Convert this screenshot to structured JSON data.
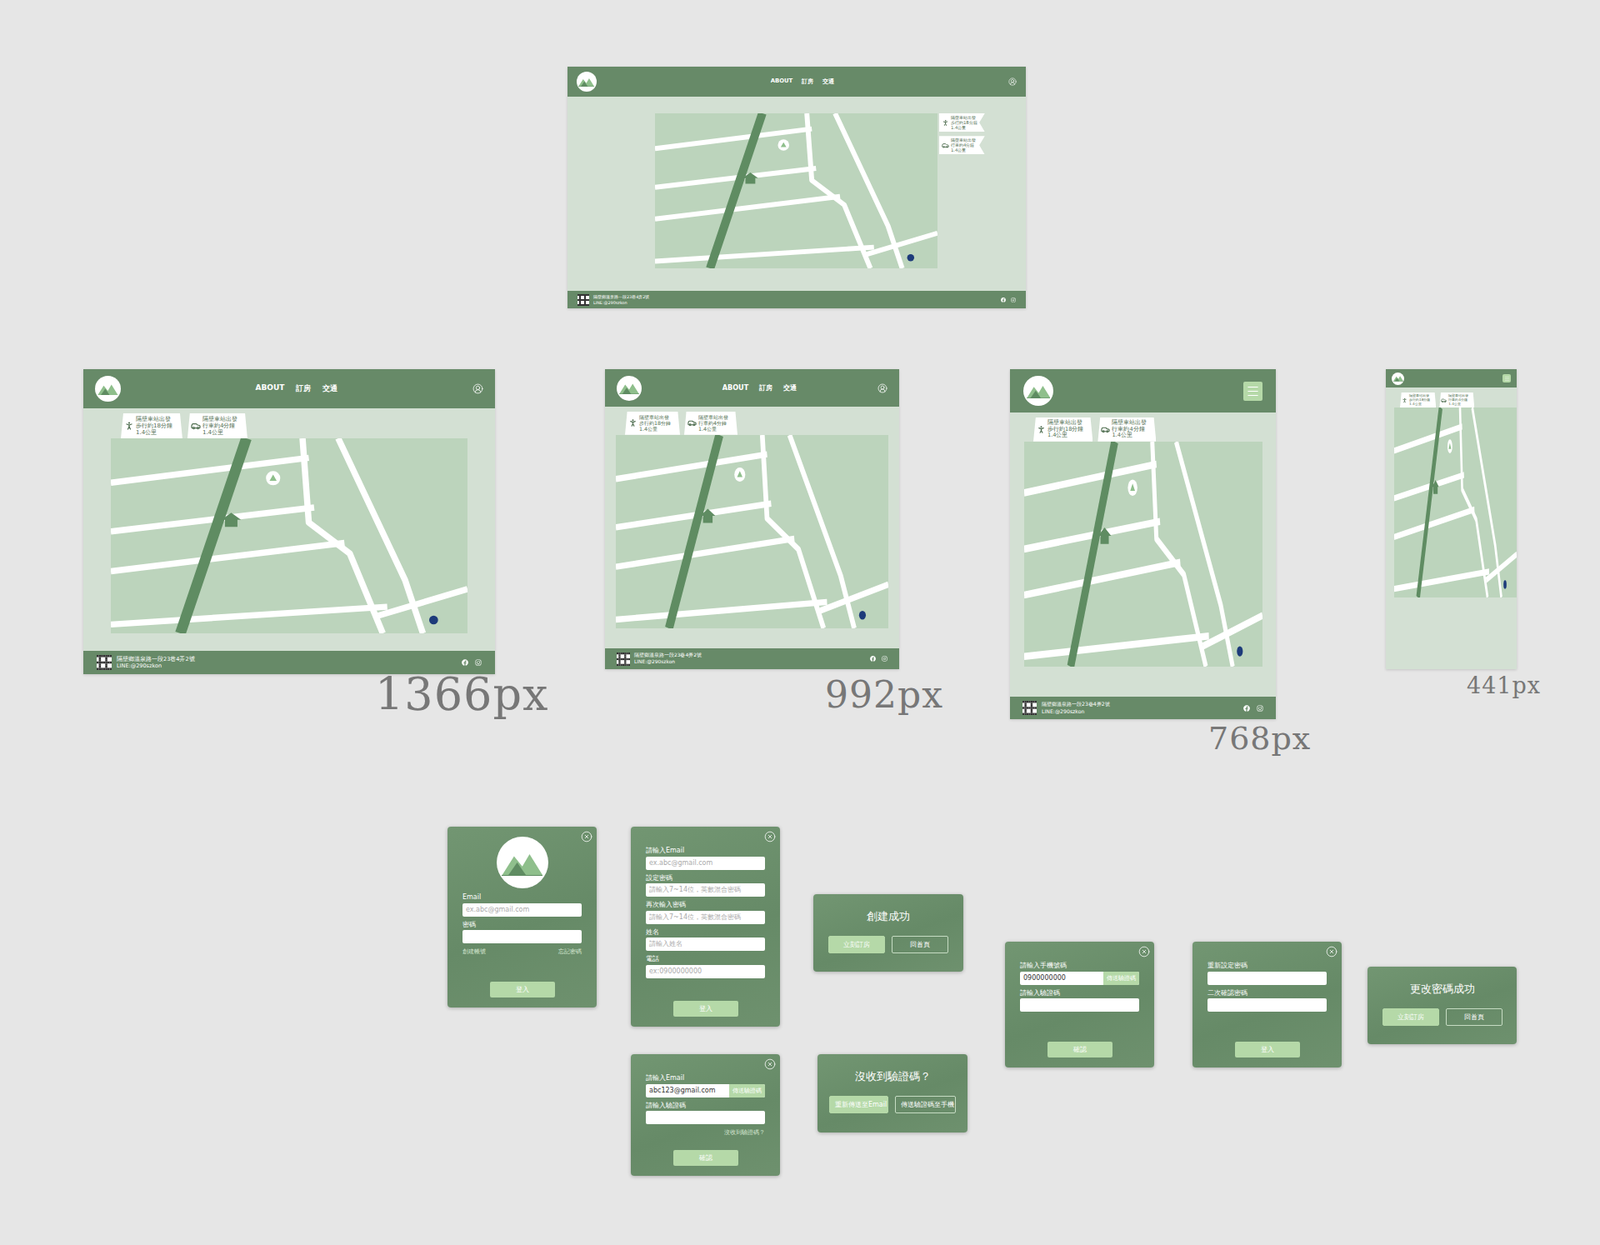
{
  "nav": {
    "links": [
      "ABOUT",
      "訂房",
      "交通"
    ]
  },
  "flags": [
    {
      "kind": "walk",
      "lines": [
        "隔壁車站出發",
        "步行約18分鐘",
        "1.4公里"
      ]
    },
    {
      "kind": "car",
      "lines": [
        "隔壁車站出發",
        "行車約4分鐘",
        "1.4公里"
      ]
    }
  ],
  "footer": {
    "address": "隔壁鄉溫泉路一段23巷4弄2號",
    "line": "LINE:@290szkon"
  },
  "mockups": [
    {
      "kind": "wide",
      "label": null
    },
    {
      "kind": "desktop",
      "label": "1366px"
    },
    {
      "kind": "desktop",
      "label": "992px"
    },
    {
      "kind": "tablet",
      "label": "768px"
    },
    {
      "kind": "mobile",
      "label": "441px"
    }
  ],
  "dialogs": [
    {
      "kind": "logo-form",
      "fields": [
        {
          "label": "Email",
          "placeholder": "ex.abc@gmail.com"
        },
        {
          "label": "密碼",
          "placeholder": ""
        }
      ],
      "links": [
        "創建帳號",
        "忘記密碼"
      ],
      "submit": "登入"
    },
    {
      "kind": "form",
      "fields": [
        {
          "label": "請輸入Email",
          "placeholder": "ex.abc@gmail.com"
        },
        {
          "label": "設定密碼",
          "placeholder": "請輸入7~14位，英數混合密碼"
        },
        {
          "label": "再次輸入密碼",
          "placeholder": "請輸入7~14位，英數混合密碼"
        },
        {
          "label": "姓名",
          "placeholder": "請輸入姓名"
        },
        {
          "label": "電話",
          "placeholder": "ex:0900000000"
        }
      ],
      "links": [],
      "submit": "登入"
    },
    {
      "kind": "message",
      "title": "創建成功",
      "buttons": [
        {
          "label": "立刻訂房",
          "kind": "filled"
        },
        {
          "label": "回首頁",
          "kind": "outline"
        }
      ]
    },
    {
      "kind": "form",
      "fields": [
        {
          "label": "請輸入Email",
          "value": "abc123@gmail.com",
          "action": "傳送驗證碼"
        },
        {
          "label": "請輸入驗證碼",
          "placeholder": ""
        }
      ],
      "links": [
        "沒收到驗證碼？"
      ],
      "submit": "確認"
    },
    {
      "kind": "message",
      "title": "沒收到驗證碼？",
      "buttons": [
        {
          "label": "重新傳送至Email",
          "kind": "filled"
        },
        {
          "label": "傳送驗證碼至手機",
          "kind": "outline"
        }
      ]
    },
    {
      "kind": "form",
      "fields": [
        {
          "label": "請輸入手機號碼",
          "value": "0900000000",
          "action": "傳送驗證碼"
        },
        {
          "label": "請輸入驗證碼",
          "placeholder": ""
        }
      ],
      "links": [],
      "submit": "確認"
    },
    {
      "kind": "form",
      "fields": [
        {
          "label": "重新設定密碼",
          "placeholder": ""
        },
        {
          "label": "二次確認密碼",
          "placeholder": ""
        }
      ],
      "links": [],
      "submit": "登入"
    },
    {
      "kind": "message",
      "title": "更改密碼成功",
      "buttons": [
        {
          "label": "立刻訂房",
          "kind": "filled"
        },
        {
          "label": "回首頁",
          "kind": "outline"
        }
      ]
    }
  ]
}
